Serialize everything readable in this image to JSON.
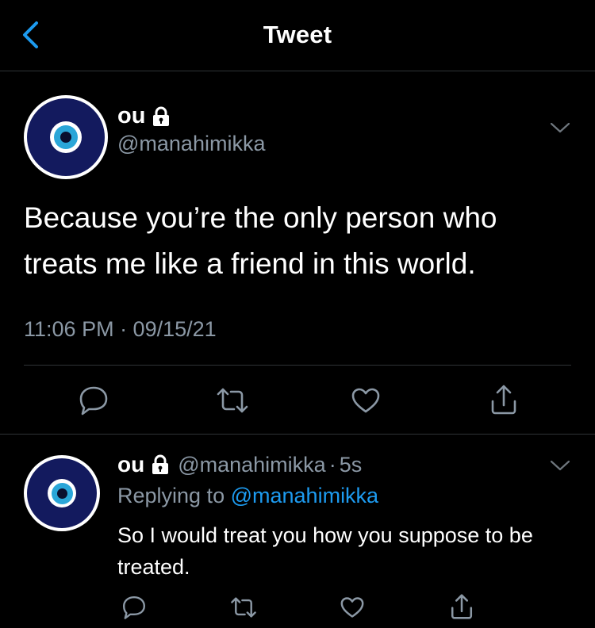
{
  "header": {
    "title": "Tweet",
    "back_icon": "chevron-left-icon"
  },
  "colors": {
    "background": "#000000",
    "accent": "#1d9bf0",
    "secondary_text": "#8b98a5",
    "divider": "#2f3336"
  },
  "main_tweet": {
    "display_name": "ou",
    "locked_icon": "lock-icon",
    "handle": "@manahimikka",
    "text": "Because you’re the only person who treats me like a friend in this world.",
    "timestamp": "11:06 PM · 09/15/21",
    "more_icon": "chevron-down-icon",
    "actions": [
      "reply-icon",
      "retweet-icon",
      "like-icon",
      "share-icon"
    ]
  },
  "reply": {
    "display_name": "ou",
    "locked_icon": "lock-icon",
    "handle": "@manahimikka",
    "separator": "·",
    "time": "5s",
    "replying_prefix": "Replying to",
    "replying_handle": "@manahimikka",
    "text": "So I would treat you how you suppose to be treated.",
    "more_icon": "chevron-down-icon",
    "actions": [
      "reply-icon",
      "retweet-icon",
      "like-icon",
      "share-icon"
    ]
  }
}
